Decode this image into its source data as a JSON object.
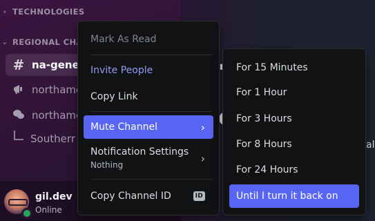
{
  "sidebar": {
    "categories": [
      {
        "label": "TECHNOLOGIES",
        "chevron": "chevron-right-icon"
      },
      {
        "label": "REGIONAL CHA",
        "chevron": "chevron-down-icon"
      }
    ],
    "channels": [
      {
        "name": "na-gener",
        "icon": "hash-icon",
        "active": true
      },
      {
        "name": "northame",
        "icon": "megaphone-icon",
        "active": false
      },
      {
        "name": "northame",
        "icon": "chat-bubbles-icon",
        "active": false
      }
    ],
    "thread": {
      "name": "Southerr"
    }
  },
  "user": {
    "name": "gil.dev",
    "status": "Online",
    "status_color": "#23a55a"
  },
  "main": {
    "hint_glyph_1": "\"",
    "hint_glyph_2": "e",
    "hint_glyph_3": "al"
  },
  "context_menu": {
    "mark_as_read": "Mark As Read",
    "invite_people": "Invite People",
    "copy_link": "Copy Link",
    "mute_channel": "Mute Channel",
    "notification_settings": "Notification Settings",
    "notification_settings_value": "Nothing",
    "copy_channel_id": "Copy Channel ID",
    "id_badge": "ID"
  },
  "mute_submenu": {
    "items": [
      "For 15 Minutes",
      "For 1 Hour",
      "For 3 Hours",
      "For 8 Hours",
      "For 24 Hours",
      "Until I turn it back on"
    ],
    "highlighted": "Until I turn it back on"
  },
  "colors": {
    "accent": "#5865f2",
    "invite_text": "#949cf7",
    "online": "#23a55a"
  }
}
